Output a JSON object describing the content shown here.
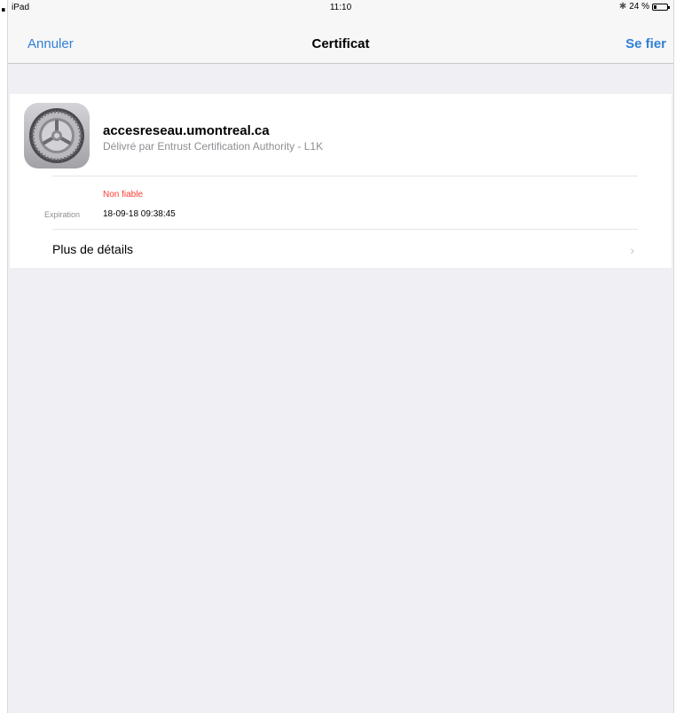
{
  "status_bar": {
    "device": "iPad",
    "time": "11:10",
    "bluetooth_icon": "bluetooth-icon",
    "battery_text": "24 %",
    "battery_level_percent": 24
  },
  "nav": {
    "cancel_label": "Annuler",
    "title": "Certificat",
    "trust_label": "Se fier",
    "accent_color": "#2f7fd7"
  },
  "certificate": {
    "icon": "settings-gear-icon",
    "name": "accesreseau.umontreal.ca",
    "issuer": "Délivré par Entrust Certification Authority - L1K",
    "trust_status": "Non fiable",
    "trust_status_color": "#ff3b30",
    "expiration_label": "Expiration",
    "expiration_value": "18-09-18 09:38:45"
  },
  "details": {
    "label": "Plus de détails",
    "chevron_icon": "chevron-right-icon"
  }
}
